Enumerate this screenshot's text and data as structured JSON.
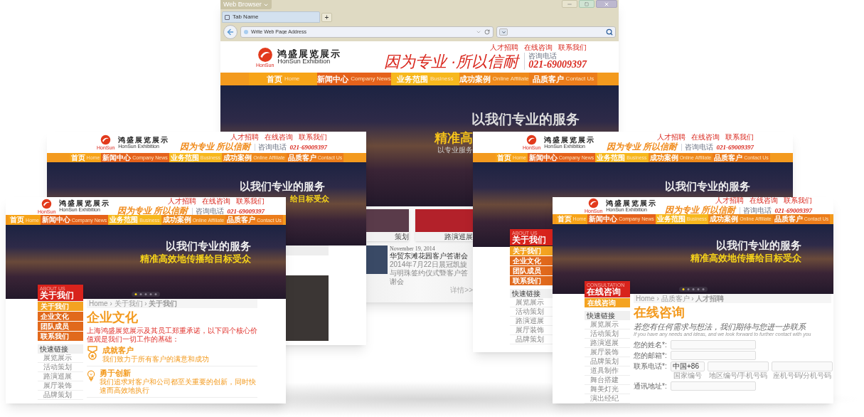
{
  "browser": {
    "menu_button": "Web Browser",
    "tab": "Tab Name",
    "new_tab": "+",
    "address": {
      "placeholder": "Write Web Page Address"
    }
  },
  "main_site": {
    "top_links": [
      "人才招聘",
      "在线咨询",
      "联系我们"
    ],
    "logo": {
      "mark": "HonSun",
      "name_cn": "鸿盛展览展示",
      "name_en": "HonSun Exhibition"
    },
    "slogan": "因为专业 ·所以信耐",
    "phone_label": "咨询电话",
    "phone": "021-69009397",
    "nav": [
      {
        "label": "首页",
        "sub": "Home"
      },
      {
        "label": "新闻中心",
        "sub": "Company News"
      },
      {
        "label": "业务范围",
        "sub": "Business"
      },
      {
        "label": "成功案例",
        "sub": "Online Affiliate"
      },
      {
        "label": "品质客户",
        "sub": "Contact Us"
      }
    ],
    "banner_lines": [
      "以我们专业的服务",
      "精准高",
      "以专业服务"
    ],
    "cases": [
      "策划",
      "路演巡展"
    ],
    "news": {
      "date": "November 19, 2014",
      "title": "华贸东滩花园客户答谢会",
      "summary": "2014年7月22日晨冠凯旋与明珠签约仪式暨客户答谢会",
      "more": "详情>>"
    }
  },
  "back_left": {
    "top_links": [
      "人才招聘",
      "在线咨询",
      "联系我们"
    ],
    "logo": {
      "mark": "HonSun",
      "name_cn": "鸿盛展览展示",
      "name_en": "HonSun Exhibition"
    },
    "slogan": "因为专业 所以信耐",
    "phone_label": "咨询电话",
    "phone": "021-69009397",
    "nav": [
      {
        "label": "首页",
        "sub": "Home"
      },
      {
        "label": "新闻中心",
        "sub": "Company News"
      },
      {
        "label": "业务范围",
        "sub": "Business"
      },
      {
        "label": "成功案例",
        "sub": "Online Affiliate"
      },
      {
        "label": "品质客户",
        "sub": "Contact Us"
      }
    ],
    "banner_lines": [
      "以我们专业的服务",
      "给目标受众"
    ]
  },
  "back_right": {
    "top_links": [
      "人才招聘",
      "在线咨询",
      "联系我们"
    ],
    "logo": {
      "mark": "HonSun",
      "name_cn": "鸿盛展览展示",
      "name_en": "HonSun Exhibition"
    },
    "slogan": "因为专业 所以信耐",
    "phone_label": "咨询电话",
    "phone": "021-69009397",
    "nav": [
      {
        "label": "首页",
        "sub": "Home"
      },
      {
        "label": "新闻中心",
        "sub": "Company News"
      },
      {
        "label": "业务范围",
        "sub": "Business"
      },
      {
        "label": "成功案例",
        "sub": "Online Affiliate"
      },
      {
        "label": "品质客户",
        "sub": "Contact Us"
      }
    ],
    "banner_lines": [
      "以我们专业的服务"
    ],
    "sidebar": {
      "title_en": "ABOUT US",
      "title_cn": "关于我们",
      "items": [
        {
          "label": "关于我们",
          "selected": true
        },
        {
          "label": "企业文化",
          "selected": false
        },
        {
          "label": "团队成员",
          "selected": false
        },
        {
          "label": "联系我们",
          "selected": false
        }
      ],
      "quick_links_title": "快速链接",
      "quick_links": [
        "展览展示",
        "活动策划",
        "路演巡展",
        "展厅装饰",
        "品牌策划"
      ]
    }
  },
  "front_left": {
    "top_links": [
      "人才招聘",
      "在线咨询",
      "联系我们"
    ],
    "logo": {
      "mark": "HonSun",
      "name_cn": "鸿盛展览展示",
      "name_en": "HonSun Exhibition"
    },
    "slogan": "因为专业 所以信耐",
    "phone_label": "咨询电话",
    "phone": "021-69009397",
    "nav": [
      {
        "label": "首页",
        "sub": "Home"
      },
      {
        "label": "新闻中心",
        "sub": "Company News"
      },
      {
        "label": "业务范围",
        "sub": "Business"
      },
      {
        "label": "成功案例",
        "sub": "Online Affiliate"
      },
      {
        "label": "品质客户",
        "sub": "Contact Us"
      }
    ],
    "banner_lines": [
      "以我们专业的服务",
      "精准高效地传播给目标受众"
    ],
    "sidebar": {
      "title_en": "ABOUT US",
      "title_cn": "关于我们",
      "items": [
        {
          "label": "关于我们",
          "selected": true
        },
        {
          "label": "企业文化",
          "selected": false
        },
        {
          "label": "团队成员",
          "selected": false
        },
        {
          "label": "联系我们",
          "selected": false
        }
      ],
      "quick_links_title": "快速链接",
      "quick_links": [
        "展览展示",
        "活动策划",
        "路演巡展",
        "展厅装饰",
        "品牌策划"
      ]
    },
    "content": {
      "breadcrumb": "Home › 关于我们 › **关于我们**",
      "title": "企业文化",
      "intro": "上海鸿盛展览展示及其员工郑重承诺，以下四个核心价值观是我们一切工作的基础：",
      "values": [
        {
          "kind": "medal",
          "title": "成就客户",
          "text": "我们致力于所有客户的满意和成功"
        },
        {
          "kind": "bulb",
          "title": "勇于创新",
          "text": "我们追求对客户和公司都至关重要的创新，同时快速而高效地执行"
        }
      ]
    }
  },
  "front_right": {
    "top_links": [
      "人才招聘",
      "在线咨询",
      "联系我们"
    ],
    "logo": {
      "mark": "HonSun",
      "name_cn": "鸿盛展览展示",
      "name_en": "HonSun Exhibition"
    },
    "slogan": "因为专业 所以信耐",
    "phone_label": "咨询电话",
    "phone": "021-69009397",
    "nav": [
      {
        "label": "首页",
        "sub": "Home"
      },
      {
        "label": "新闻中心",
        "sub": "Company News"
      },
      {
        "label": "业务范围",
        "sub": "Business"
      },
      {
        "label": "成功案例",
        "sub": "Online Affiliate"
      },
      {
        "label": "品质客户",
        "sub": "Contact Us"
      }
    ],
    "banner_lines": [
      "以我们专业的服务",
      "精准高效地传播给目标受众"
    ],
    "sidebar": {
      "title_en": "CONSULTATION",
      "title_cn": "在线咨询",
      "items": [
        {
          "label": "在线咨询",
          "selected": true
        }
      ],
      "quick_links_title": "快速链接",
      "quick_links": [
        "展览展示",
        "活动策划",
        "路演巡展",
        "展厅装饰",
        "品牌策划",
        "道具制作",
        "舞台搭建",
        "舞美灯光",
        "演出经纪"
      ]
    },
    "content": {
      "breadcrumb": "Home › 品质客户 › **人才招聘**",
      "title": "在线咨询",
      "intro": "若您有任何需求与想法，我们期待与您进一步联系",
      "intro_en": "If you have any needs and ideas, and we look forward to further contact with you",
      "form": [
        {
          "label": "您的姓名*:"
        },
        {
          "label": "您的邮箱*:"
        },
        {
          "label": "联系电话*:",
          "fields": [
            {
              "value": "中国+86",
              "hint": "国家编号"
            },
            {
              "hint": "地区编号/手机号码"
            },
            {
              "hint": "座机号码/分机号码"
            }
          ]
        },
        {
          "label": "通讯地址*:"
        }
      ]
    }
  }
}
